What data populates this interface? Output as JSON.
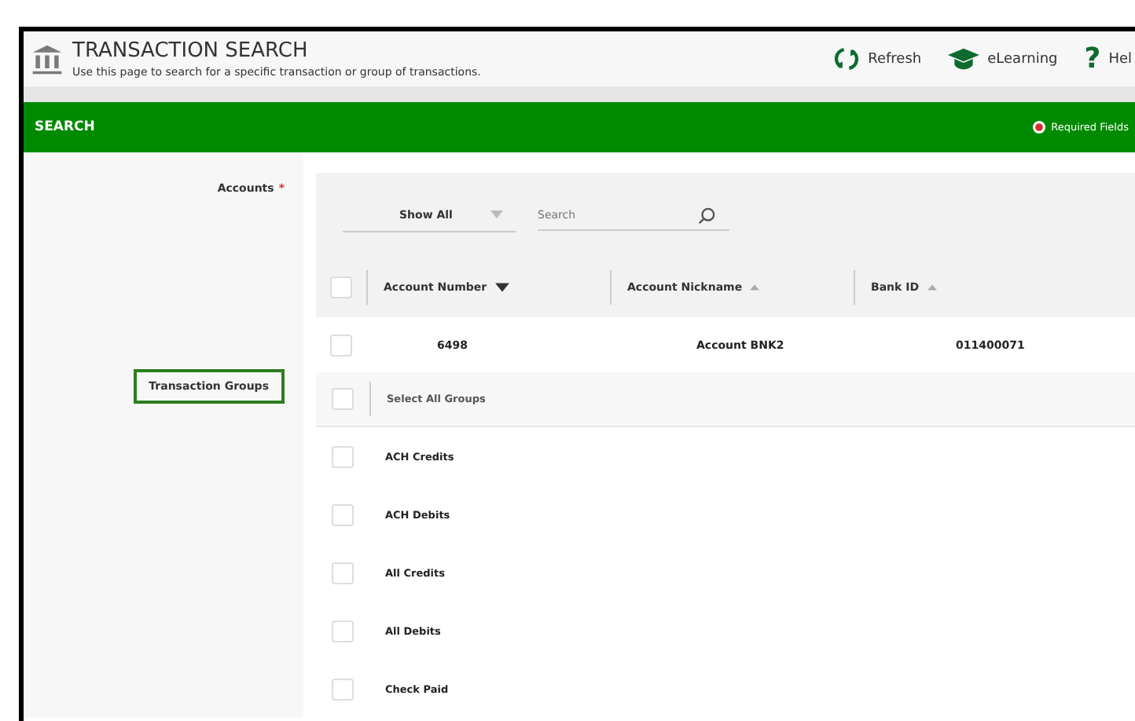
{
  "header": {
    "title": "TRANSACTION SEARCH",
    "subtitle": "Use this page to search for a specific transaction or group of transactions.",
    "actions": [
      {
        "kind": "refresh",
        "label": "Refresh"
      },
      {
        "kind": "learning",
        "label": "eLearning"
      },
      {
        "kind": "help",
        "icon": "?",
        "label": "Hel"
      }
    ]
  },
  "section_bar": {
    "title": "SEARCH",
    "required_note": "Required Fields"
  },
  "accounts": {
    "label": "Accounts",
    "required_mark": "*",
    "filter": {
      "value": "Show All"
    },
    "search": {
      "placeholder": "Search"
    },
    "select_all_checked": false,
    "columns": [
      {
        "label": "Account Number",
        "descending": true,
        "active": true
      },
      {
        "label": "Account Nickname",
        "descending": false,
        "active": false
      },
      {
        "label": "Bank ID",
        "descending": false,
        "active": false
      }
    ],
    "rows": [
      {
        "checked": false,
        "cells": [
          "6498",
          "Account BNK2",
          "011400071"
        ]
      }
    ]
  },
  "groups": {
    "label": "Transaction Groups",
    "highlighted": true,
    "select_all": {
      "label": "Select All Groups",
      "checked": false
    },
    "items": [
      {
        "label": "ACH Credits",
        "checked": false
      },
      {
        "label": "ACH Debits",
        "checked": false
      },
      {
        "label": "All Credits",
        "checked": false
      },
      {
        "label": "All Debits",
        "checked": false
      },
      {
        "label": "Check Paid",
        "checked": false
      }
    ]
  }
}
